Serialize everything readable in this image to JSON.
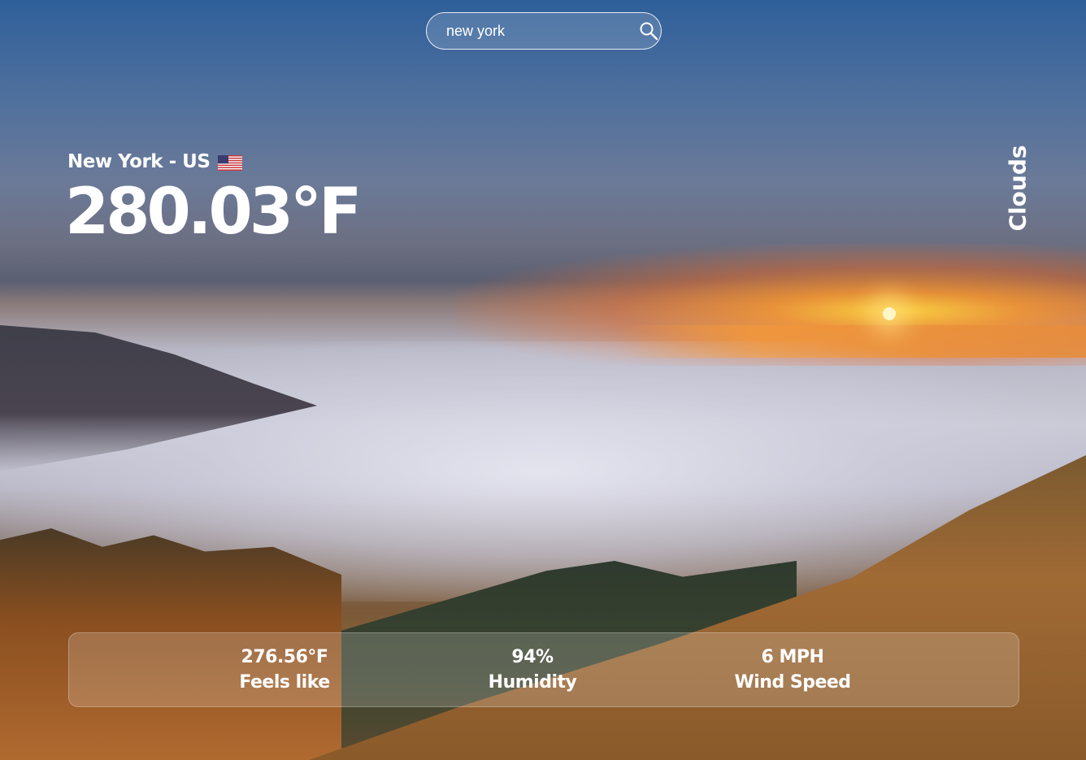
{
  "search": {
    "value": "new york",
    "icon": "search-icon"
  },
  "location": {
    "text": "New York - US",
    "flag_icon": "us-flag-icon"
  },
  "temperature": "280.03°F",
  "condition": "Clouds",
  "stats": {
    "feels_like": {
      "value": "276.56°F",
      "label": "Feels like"
    },
    "humidity": {
      "value": "94%",
      "label": "Humidity"
    },
    "wind_speed": {
      "value": "6 MPH",
      "label": "Wind Speed"
    }
  },
  "colors": {
    "text": "#ffffff",
    "glass_panel": "rgba(255,255,255,0.18)"
  }
}
